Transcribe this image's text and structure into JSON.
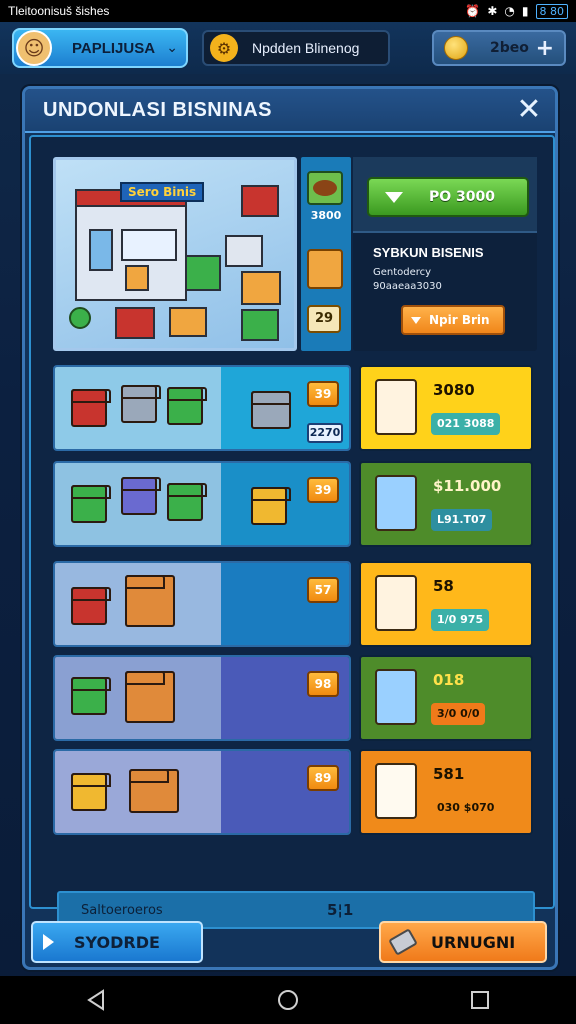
{
  "status_bar": {
    "title": "Tleitoonisuš šishes",
    "battery": "8 80"
  },
  "top_bar": {
    "player_name": "PAPLIJUSA",
    "mid_label": "Npdden Blinenog",
    "coin_value": "2beo",
    "plus": "+"
  },
  "modal": {
    "title": "UNDONLASI BISNINAS",
    "close": "✕"
  },
  "hero": {
    "sign_label": "Sero Binis",
    "badge_value": "3800",
    "level_value": "29",
    "buy_label": "PO 3000",
    "biz_name": "SYBKUN BISENIS",
    "biz_line1": "Gentodercy",
    "biz_line2": "90aaeaa3030",
    "upgrade_label": "Npir Brin"
  },
  "rows": [
    {
      "level": "39",
      "count": "2270",
      "price": "3080",
      "sub": "021 3088",
      "price_color": "#ffd21a",
      "sub_bg": "#3bb0a8",
      "sub_fg": "#ffffff"
    },
    {
      "level": "39",
      "count": "",
      "price": "$11.000",
      "sub": "L91.T07",
      "price_color": "#5a9a2c",
      "sub_bg": "#2e8fa0",
      "sub_fg": "#ffffff"
    },
    {
      "level": "57",
      "count": "",
      "price": "58",
      "sub": "1/0 975",
      "price_color": "#ffb81a",
      "sub_bg": "#3bb0a8",
      "sub_fg": "#ffffff"
    },
    {
      "level": "98",
      "count": "",
      "price": "018",
      "sub": "3/0 0/0",
      "price_color": "#5a9a2c",
      "sub_bg": "#f07a1a",
      "sub_fg": "#1c1200"
    },
    {
      "level": "89",
      "count": "",
      "price": "581",
      "sub": "030  $070",
      "price_color": "#f08a1a",
      "sub_bg": "#f08a1a",
      "sub_fg": "#1c1200"
    }
  ],
  "footer": {
    "label": "Saltoeroeros",
    "value": "5¦1"
  },
  "buttons": {
    "left": "SYODRDE",
    "right": "URNUGNI"
  },
  "colors": {
    "accent": "#2d90d0",
    "green": "#3b9a20",
    "orange": "#f08a10"
  }
}
